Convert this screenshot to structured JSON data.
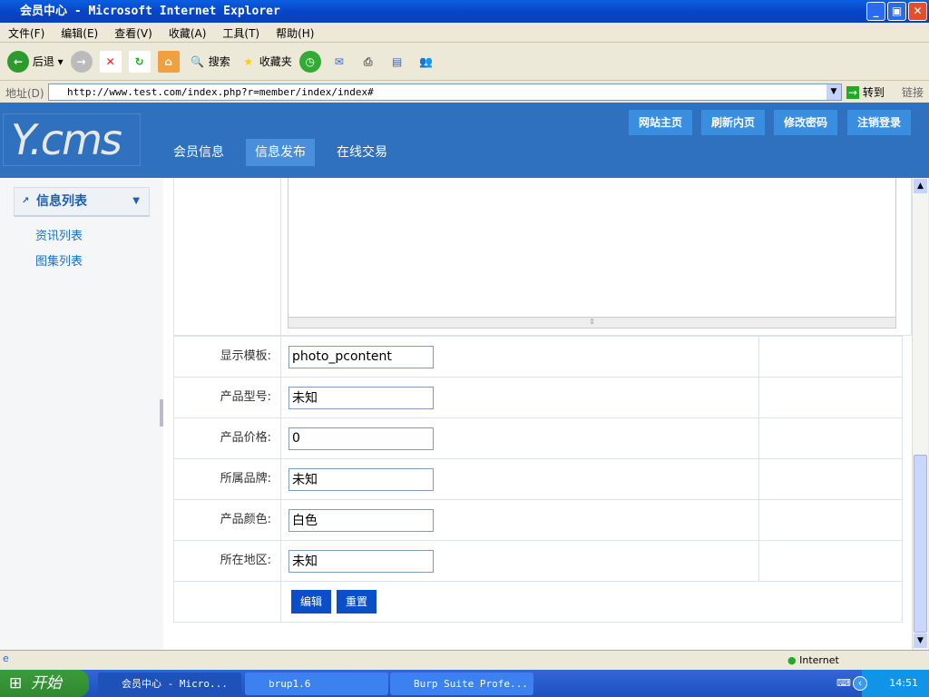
{
  "window": {
    "title": "会员中心 - Microsoft Internet Explorer"
  },
  "menu": [
    "文件(F)",
    "编辑(E)",
    "查看(V)",
    "收藏(A)",
    "工具(T)",
    "帮助(H)"
  ],
  "toolbar": {
    "back": "后退",
    "search": "搜索",
    "favorites": "收藏夹"
  },
  "address": {
    "label": "地址(D)",
    "url": "http://www.test.com/index.php?r=member/index/index#",
    "go": "转到",
    "links": "链接"
  },
  "header": {
    "logo": "Y.cms",
    "nav": [
      "会员信息",
      "信息发布",
      "在线交易"
    ],
    "buttons": [
      "网站主页",
      "刷新内页",
      "修改密码",
      "注销登录"
    ]
  },
  "sidebar": {
    "section": "信息列表",
    "items": [
      "资讯列表",
      "图集列表"
    ]
  },
  "form": {
    "rows": [
      {
        "label": "显示模板:",
        "value": "photo_pcontent"
      },
      {
        "label": "产品型号:",
        "value": "未知"
      },
      {
        "label": "产品价格:",
        "value": "0"
      },
      {
        "label": "所属品牌:",
        "value": "未知"
      },
      {
        "label": "产品颜色:",
        "value": "白色"
      },
      {
        "label": "所在地区:",
        "value": "未知"
      }
    ],
    "submit": "编辑",
    "reset": "重置"
  },
  "status": {
    "zone": "Internet"
  },
  "taskbar": {
    "start": "开始",
    "tasks": [
      "会员中心 - Micro...",
      "brup1.6",
      "Burp Suite Profe..."
    ],
    "clock": "14:51"
  }
}
